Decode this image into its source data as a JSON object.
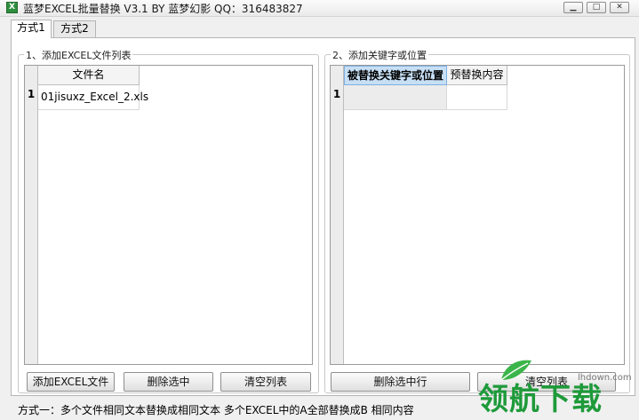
{
  "window": {
    "title": "蓝梦EXCEL批量替换 V3.1 BY 蓝梦幻影 QQ：316483827",
    "icon": "excel-app-icon",
    "controls": [
      "minimize",
      "restore",
      "close"
    ]
  },
  "tabs": [
    {
      "label": "方式1",
      "active": true
    },
    {
      "label": "方式2",
      "active": false
    }
  ],
  "left_group": {
    "title": "1、添加EXCEL文件列表",
    "grid": {
      "columns": [
        "文件名"
      ],
      "rows": [
        {
          "num": "1",
          "cells": [
            "01jisuxz_Excel_2.xls"
          ]
        }
      ]
    },
    "buttons": {
      "add": "添加EXCEL文件",
      "delete": "删除选中",
      "clear": "清空列表"
    }
  },
  "right_group": {
    "title": "2、添加关键字或位置",
    "grid": {
      "columns": [
        "被替换关键字或位置",
        "预替换内容"
      ],
      "rows": [
        {
          "num": "1",
          "cells": [
            "",
            ""
          ]
        }
      ]
    },
    "buttons": {
      "delete_row": "删除选中行",
      "clear": "清空列表"
    }
  },
  "status_text": "方式一：多个文件相同文本替换成相同文本  多个EXCEL中的A全部替换成B 相同内容",
  "watermark": {
    "url": "lhdown.com",
    "text": "领航下载"
  },
  "colors": {
    "accent_selected": "#c7dff5",
    "watermark_green": "#1e9a3a"
  }
}
